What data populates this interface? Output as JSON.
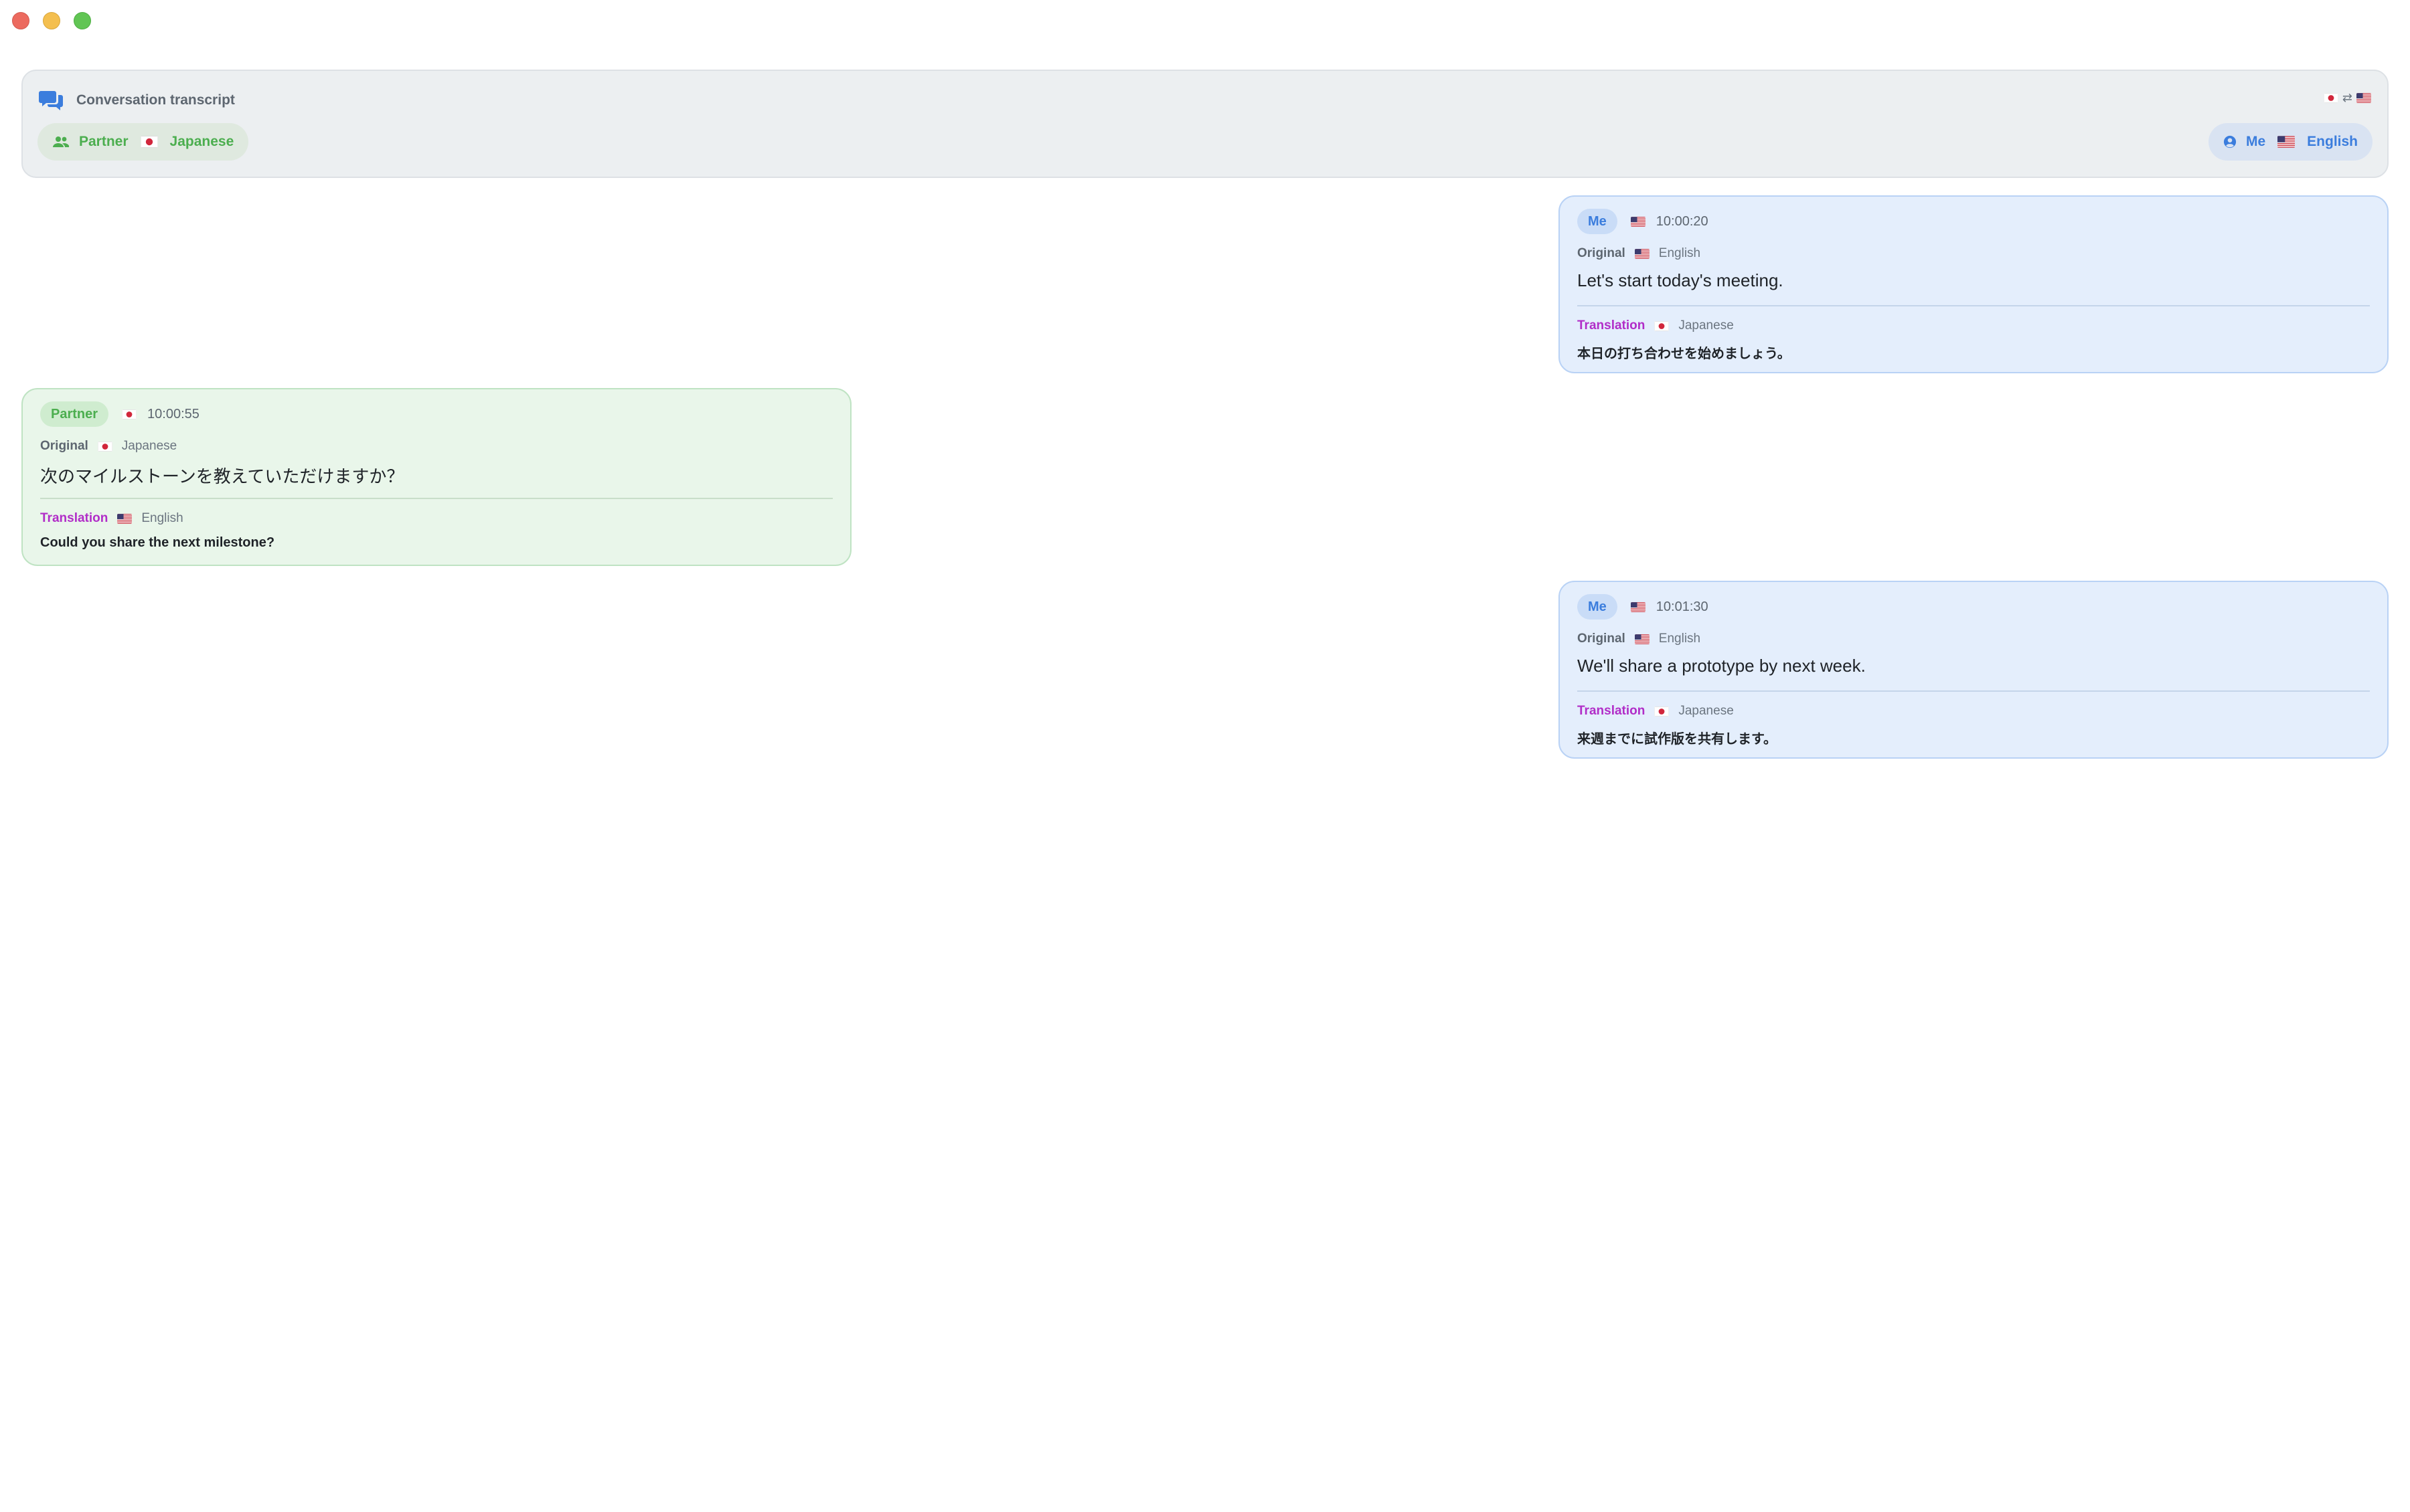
{
  "window": {
    "controls": [
      "close",
      "minimize",
      "zoom"
    ]
  },
  "header": {
    "title": "Conversation transcript",
    "icon": "chat-bubbles-icon",
    "direction": {
      "from_flag": "japan-flag",
      "arrow": "⇄",
      "to_flag": "us-flag"
    },
    "partner_pill": {
      "icon": "people-icon",
      "label": "Partner",
      "flag": "japan-flag",
      "language": "Japanese"
    },
    "me_pill": {
      "icon": "user-circle-icon",
      "label": "Me",
      "flag": "us-flag",
      "language": "English"
    }
  },
  "messages": [
    {
      "speaker": "Me",
      "flag": "us-flag",
      "time": "10:00:20",
      "original_label": "Original",
      "original_language": "English",
      "original_text": "Let's start today's meeting.",
      "translation_label": "Translation",
      "translation_language": "Japanese",
      "translation_text": "本日の打ち合わせを始めましょう。"
    },
    {
      "speaker": "Partner",
      "flag": "japan-flag",
      "time": "10:00:55",
      "original_label": "Original",
      "original_language": "Japanese",
      "original_text": "次のマイルストーンを教えていただけますか？",
      "translation_label": "Translation",
      "translation_language": "English",
      "translation_text": "Could you share the next milestone?"
    },
    {
      "speaker": "Me",
      "flag": "us-flag",
      "time": "10:01:30",
      "original_label": "Original",
      "original_language": "English",
      "original_text": "We'll share a prototype by next week.",
      "translation_label": "Translation",
      "translation_language": "Japanese",
      "translation_text": "来週までに試作版を共有します。"
    }
  ],
  "colors": {
    "me_accent": "#3b7ddd",
    "partner_accent": "#4cae4f",
    "translation_accent": "#b12dc8"
  }
}
